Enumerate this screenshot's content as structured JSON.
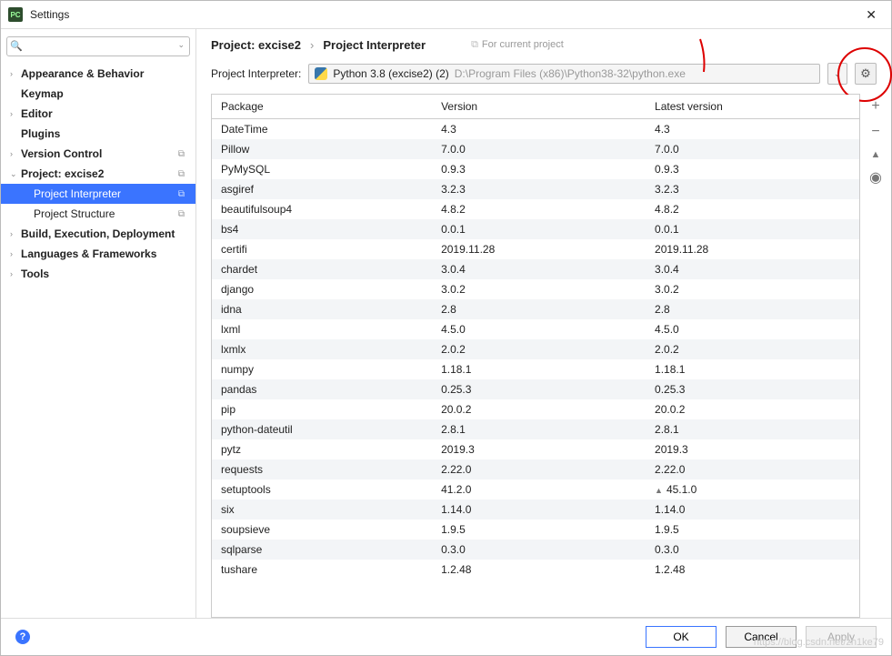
{
  "titlebar": {
    "app_icon_text": "PC",
    "title": "Settings",
    "close": "✕"
  },
  "search": {
    "placeholder": ""
  },
  "sidebar": [
    {
      "label": "Appearance & Behavior",
      "chev": "›",
      "bold": true
    },
    {
      "label": "Keymap",
      "chev": "",
      "bold": true
    },
    {
      "label": "Editor",
      "chev": "›",
      "bold": true
    },
    {
      "label": "Plugins",
      "chev": "",
      "bold": true
    },
    {
      "label": "Version Control",
      "chev": "›",
      "bold": true,
      "copy": true
    },
    {
      "label": "Project: excise2",
      "chev": "⌄",
      "bold": true,
      "copy": true,
      "children": [
        {
          "label": "Project Interpreter",
          "copy": true,
          "selected": true
        },
        {
          "label": "Project Structure",
          "copy": true
        }
      ]
    },
    {
      "label": "Build, Execution, Deployment",
      "chev": "›",
      "bold": true
    },
    {
      "label": "Languages & Frameworks",
      "chev": "›",
      "bold": true
    },
    {
      "label": "Tools",
      "chev": "›",
      "bold": true
    }
  ],
  "breadcrumb": {
    "a": "Project: excise2",
    "sep": "›",
    "b": "Project Interpreter",
    "hint": "For current project"
  },
  "interpreter": {
    "label": "Project Interpreter:",
    "name": "Python 3.8 (excise2) (2)",
    "path": "D:\\Program Files (x86)\\Python38-32\\python.exe"
  },
  "columns": {
    "pkg": "Package",
    "ver": "Version",
    "latest": "Latest version"
  },
  "packages": [
    {
      "n": "DateTime",
      "v": "4.3",
      "l": "4.3"
    },
    {
      "n": "Pillow",
      "v": "7.0.0",
      "l": "7.0.0"
    },
    {
      "n": "PyMySQL",
      "v": "0.9.3",
      "l": "0.9.3"
    },
    {
      "n": "asgiref",
      "v": "3.2.3",
      "l": "3.2.3"
    },
    {
      "n": "beautifulsoup4",
      "v": "4.8.2",
      "l": "4.8.2"
    },
    {
      "n": "bs4",
      "v": "0.0.1",
      "l": "0.0.1"
    },
    {
      "n": "certifi",
      "v": "2019.11.28",
      "l": "2019.11.28"
    },
    {
      "n": "chardet",
      "v": "3.0.4",
      "l": "3.0.4"
    },
    {
      "n": "django",
      "v": "3.0.2",
      "l": "3.0.2"
    },
    {
      "n": "idna",
      "v": "2.8",
      "l": "2.8"
    },
    {
      "n": "lxml",
      "v": "4.5.0",
      "l": "4.5.0"
    },
    {
      "n": "lxmlx",
      "v": "2.0.2",
      "l": "2.0.2"
    },
    {
      "n": "numpy",
      "v": "1.18.1",
      "l": "1.18.1"
    },
    {
      "n": "pandas",
      "v": "0.25.3",
      "l": "0.25.3"
    },
    {
      "n": "pip",
      "v": "20.0.2",
      "l": "20.0.2"
    },
    {
      "n": "python-dateutil",
      "v": "2.8.1",
      "l": "2.8.1"
    },
    {
      "n": "pytz",
      "v": "2019.3",
      "l": "2019.3"
    },
    {
      "n": "requests",
      "v": "2.22.0",
      "l": "2.22.0"
    },
    {
      "n": "setuptools",
      "v": "41.2.0",
      "l": "45.1.0",
      "up": true
    },
    {
      "n": "six",
      "v": "1.14.0",
      "l": "1.14.0"
    },
    {
      "n": "soupsieve",
      "v": "1.9.5",
      "l": "1.9.5"
    },
    {
      "n": "sqlparse",
      "v": "0.3.0",
      "l": "0.3.0"
    },
    {
      "n": "tushare",
      "v": "1.2.48",
      "l": "1.2.48"
    }
  ],
  "sidebtns": {
    "add": "+",
    "remove": "−",
    "up": "▲",
    "eye": "◉"
  },
  "footer": {
    "ok": "OK",
    "cancel": "Cancel",
    "apply": "Apply"
  },
  "watermark": "https://blog.csdn.net/zh1ke79"
}
